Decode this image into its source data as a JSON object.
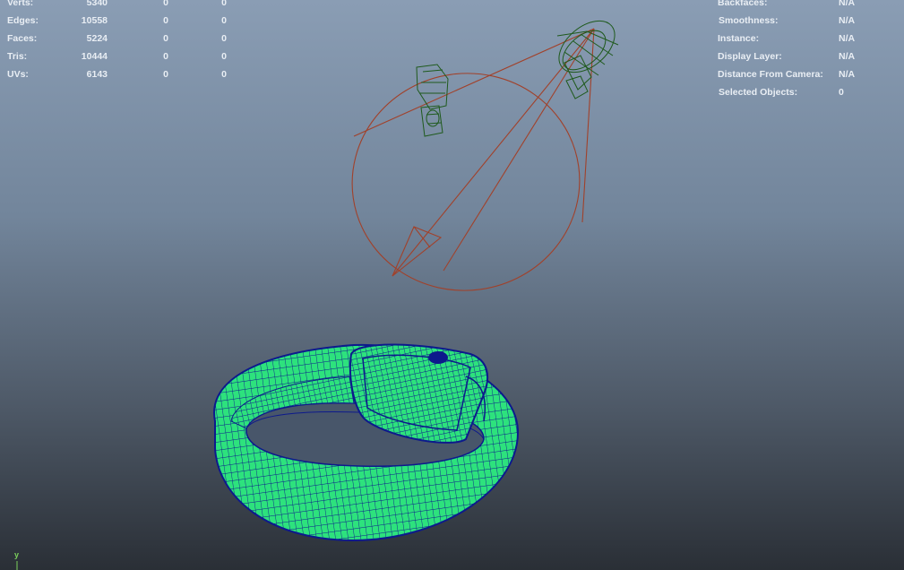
{
  "hud_left": {
    "rows": [
      {
        "label": "Verts:",
        "total": "5340",
        "sel": "0",
        "sel2": "0"
      },
      {
        "label": "Edges:",
        "total": "10558",
        "sel": "0",
        "sel2": "0"
      },
      {
        "label": "Faces:",
        "total": "5224",
        "sel": "0",
        "sel2": "0"
      },
      {
        "label": "Tris:",
        "total": "10444",
        "sel": "0",
        "sel2": "0"
      },
      {
        "label": "UVs:",
        "total": "6143",
        "sel": "0",
        "sel2": "0"
      }
    ]
  },
  "hud_right": {
    "rows": [
      {
        "label": "Backfaces:",
        "value": "N/A"
      },
      {
        "label": "Smoothness:",
        "value": "N/A"
      },
      {
        "label": "Instance:",
        "value": "N/A"
      },
      {
        "label": "Display Layer:",
        "value": "N/A"
      },
      {
        "label": "Distance From Camera:",
        "value": "N/A"
      },
      {
        "label": "Selected Objects:",
        "value": "0"
      }
    ]
  },
  "axis": {
    "label": "y"
  },
  "colors": {
    "mesh_fill": "#2de27d",
    "mesh_wire": "#0d1a8c",
    "light_wire": "#a1412a",
    "camera_wire": "#1f5a1c"
  }
}
